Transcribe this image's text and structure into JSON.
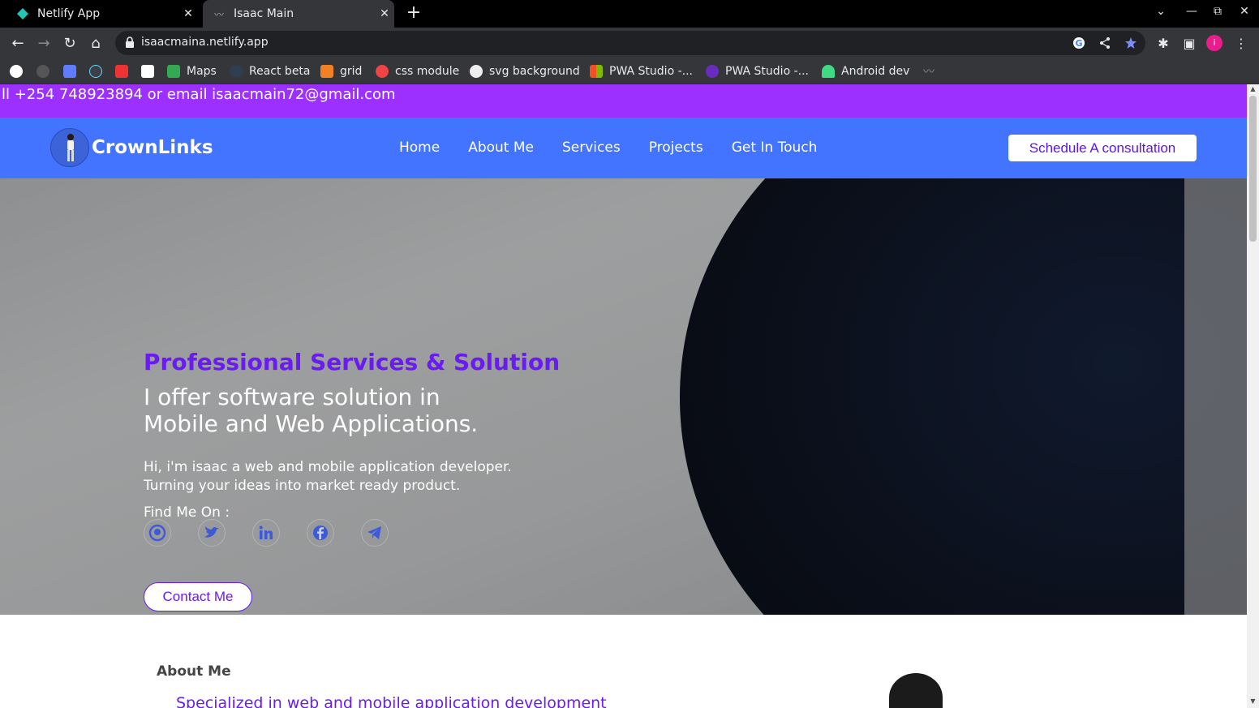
{
  "browser": {
    "tabs": [
      {
        "title": "Netlify App",
        "active": false,
        "icon": "netlify-icon"
      },
      {
        "title": "Isaac Main",
        "active": true,
        "icon": "signature-icon"
      }
    ],
    "url": "isaacmaina.netlify.app",
    "bookmarks": [
      {
        "label": "",
        "icon": "google-icon"
      },
      {
        "label": "",
        "icon": "github-icon"
      },
      {
        "label": "",
        "icon": "flag-icon"
      },
      {
        "label": "",
        "icon": "react-icon"
      },
      {
        "label": "",
        "icon": "dots-icon"
      },
      {
        "label": "",
        "icon": "amazon-icon"
      },
      {
        "label": "Maps",
        "icon": "maps-icon"
      },
      {
        "label": "React beta",
        "icon": "react-icon"
      },
      {
        "label": "grid",
        "icon": "grid-icon"
      },
      {
        "label": "css module",
        "icon": "css-icon"
      },
      {
        "label": "svg background",
        "icon": "svg-icon"
      },
      {
        "label": "PWA Studio -...",
        "icon": "microsoft-icon"
      },
      {
        "label": "PWA Studio -...",
        "icon": "pwa-icon"
      },
      {
        "label": "Android dev",
        "icon": "android-icon"
      }
    ]
  },
  "site": {
    "topbar_text": "ll +254 748923894 or email isaacmain72@gmail.com",
    "brand": "CrownLinks",
    "nav": [
      "Home",
      "About Me",
      "Services",
      "Projects",
      "Get In Touch"
    ],
    "cta": "Schedule A consultation",
    "hero": {
      "eyebrow": "Professional Services & Solution",
      "title_line1": "I offer software solution in",
      "title_line2": "Mobile and Web Applications.",
      "sub_line1": "Hi, i'm isaac a web and mobile application developer.",
      "sub_line2": "Turning your ideas into market ready product.",
      "find_me": "Find Me On :",
      "socials": [
        "github-icon",
        "twitter-icon",
        "linkedin-icon",
        "facebook-icon",
        "telegram-icon"
      ],
      "contact_button": "Contact Me"
    },
    "about": {
      "heading": "About Me",
      "tagline": "Specialized in web and mobile application development"
    }
  },
  "colors": {
    "topbar": "#9b30ff",
    "navbar": "#4274ff",
    "accent": "#6a1cf0"
  }
}
